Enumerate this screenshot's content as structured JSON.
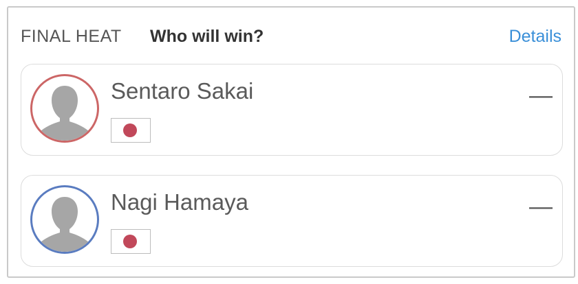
{
  "header": {
    "heat_label": "FINAL HEAT",
    "question": "Who will win?",
    "details_link": "Details"
  },
  "athletes": [
    {
      "name": "Sentaro Sakai",
      "flag": "japan-flag-icon",
      "ring_color": "#cc6666",
      "pick": "—"
    },
    {
      "name": "Nagi Hamaya",
      "flag": "japan-flag-icon",
      "ring_color": "#5a7cc0",
      "pick": "—"
    }
  ],
  "colors": {
    "link": "#3a8fd8",
    "flag_red": "#c1485a",
    "card_border": "#c9c9c9"
  }
}
